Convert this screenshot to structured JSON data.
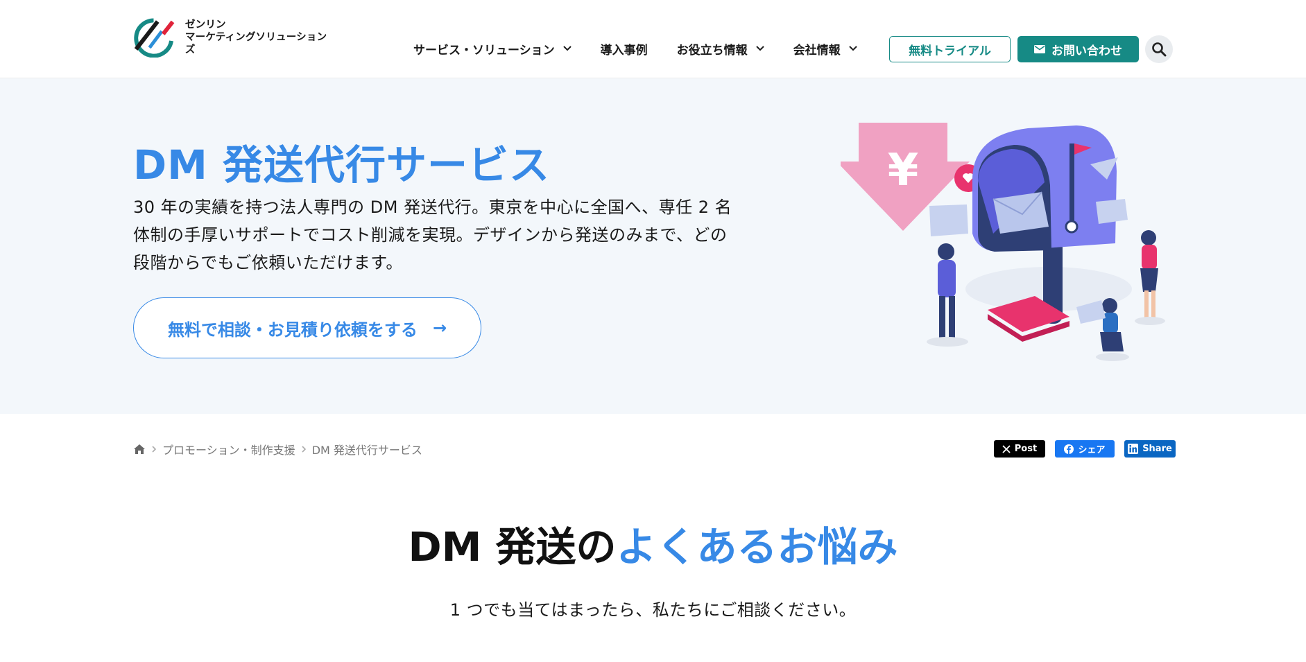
{
  "header": {
    "logo_line1": "ゼンリン",
    "logo_line2": "マーケティングソリューションズ",
    "nav": [
      {
        "label": "サービス・ソリューション",
        "has_dropdown": true
      },
      {
        "label": "導入事例",
        "has_dropdown": false
      },
      {
        "label": "お役立ち情報",
        "has_dropdown": true
      },
      {
        "label": "会社情報",
        "has_dropdown": true
      }
    ],
    "trial_label": "無料トライアル",
    "contact_label": "お問い合わせ",
    "icons": {
      "search": "search-icon",
      "mail": "mail-icon",
      "chevron": "chevron-down-icon"
    }
  },
  "hero": {
    "title": "DM 発送代行サービス",
    "description": "30 年の実績を持つ法人専門の DM 発送代行。東京を中心に全国へ、専任 2 名体制の手厚いサポートでコスト削減を実現。デザインから発送のみまで、どの段階からでもご依頼いただけます。",
    "cta_label": "無料で相談・お見積り依頼をする",
    "cta_arrow": "→"
  },
  "breadcrumb": {
    "items": [
      "プロモーション・制作支援",
      "DM 発送代行サービス"
    ]
  },
  "share": {
    "x_label": "Post",
    "fb_label": "シェア",
    "li_label": "Share"
  },
  "section": {
    "title_prefix": "DM 発送の",
    "title_accent": "よくあるお悩み",
    "subtitle": "1 つでも当てはまったら、私たちにご相談ください。"
  },
  "colors": {
    "brand_teal": "#168a85",
    "accent_blue": "#3789e6",
    "hero_bg": "#f3f7fb"
  }
}
